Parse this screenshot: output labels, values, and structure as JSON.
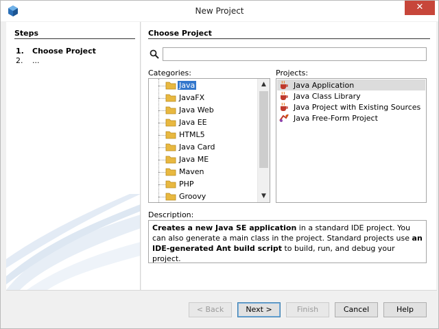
{
  "window": {
    "title": "New Project",
    "close_label": "✕"
  },
  "steps": {
    "title": "Steps",
    "items": [
      {
        "num": "1.",
        "label": "Choose Project"
      },
      {
        "num": "2.",
        "label": "..."
      }
    ]
  },
  "main": {
    "title": "Choose Project",
    "search": {
      "value": "",
      "placeholder": ""
    },
    "categories_label": "Categories:",
    "projects_label": "Projects:",
    "description_label": "Description:",
    "categories": [
      "Java",
      "JavaFX",
      "Java Web",
      "Java EE",
      "HTML5",
      "Java Card",
      "Java ME",
      "Maven",
      "PHP",
      "Groovy"
    ],
    "selected_category": "Java",
    "projects": [
      {
        "label": "Java Application",
        "icon": "coffee-cup-icon"
      },
      {
        "label": "Java Class Library",
        "icon": "coffee-cup-icon"
      },
      {
        "label": "Java Project with Existing Sources",
        "icon": "coffee-cup-icon"
      },
      {
        "label": "Java Free-Form Project",
        "icon": "freeform-project-icon"
      }
    ],
    "selected_project": "Java Application",
    "description": {
      "p1_bold": "Creates a new Java SE application",
      "p1_rest": " in a standard IDE project. You can also generate a main class in the project. Standard projects use ",
      "p2_bold": "an IDE-generated Ant build script",
      "p2_rest": " to build, run, and debug your project."
    }
  },
  "buttons": {
    "back": "< Back",
    "next": "Next >",
    "finish": "Finish",
    "cancel": "Cancel",
    "help": "Help"
  },
  "colors": {
    "selection": "#3377cc",
    "close_button": "#c7463a",
    "folder": "#e8b840"
  }
}
